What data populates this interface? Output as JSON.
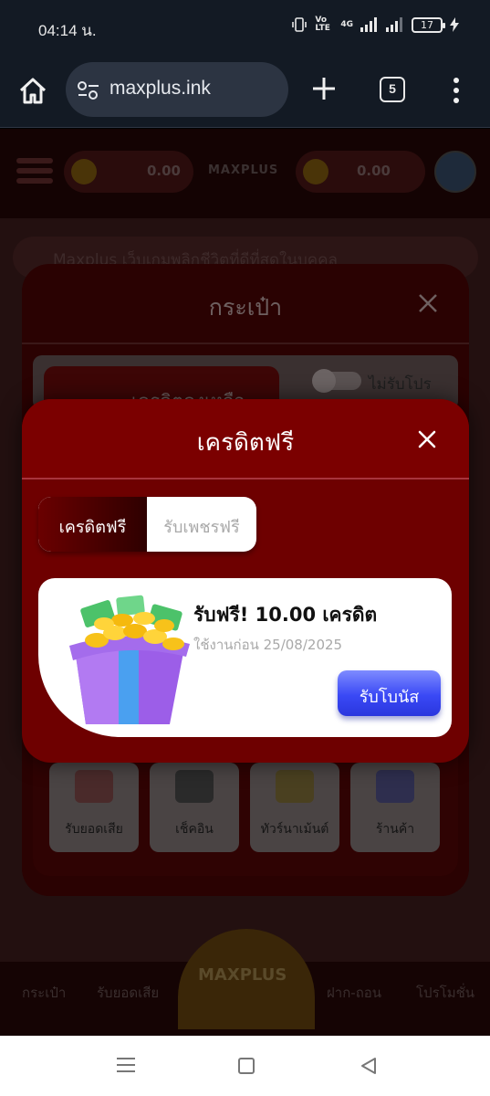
{
  "status_bar": {
    "time": "04:14 น.",
    "volte": "Vo LTE",
    "network": "4G",
    "battery": "17"
  },
  "browser": {
    "url": "maxplus.ink",
    "tab_count": "5"
  },
  "background_page": {
    "balance_left": "0.00",
    "balance_right": "0.00",
    "logo": "MAXPLUS",
    "marquee": "Maxplus เว็บเกมพลิกชีวิตที่ดีที่สุดในบุคคล",
    "bottom_nav": [
      "กระเป๋า",
      "รับยอดเสีย",
      "ฝาก-ถอน",
      "โปรโมชั่น"
    ],
    "center_logo": "MAXPLUS"
  },
  "wallet_dialog": {
    "title": "กระเป๋า",
    "credit_label": "เครดิตคงเหลือ",
    "promo_toggle_label": "ไม่รับโปร",
    "tiles": [
      "รับยอดเสีย",
      "เช็คอิน",
      "ทัวร์นาเม้นต์",
      "ร้านค้า"
    ]
  },
  "free_credit_dialog": {
    "title": "เครดิตฟรี",
    "tabs": {
      "active": "เครดิตฟรี",
      "inactive": "รับเพชรฟรี"
    },
    "offer": {
      "title": "รับฟรี! 10.00 เครดิต",
      "expiry": "ใช้งานก่อน 25/08/2025",
      "claim_label": "รับโบนัส"
    }
  },
  "colors": {
    "dialog_bg": "#6e0000",
    "claim_button": "#3a49f5",
    "browser_bar": "#131a24"
  }
}
